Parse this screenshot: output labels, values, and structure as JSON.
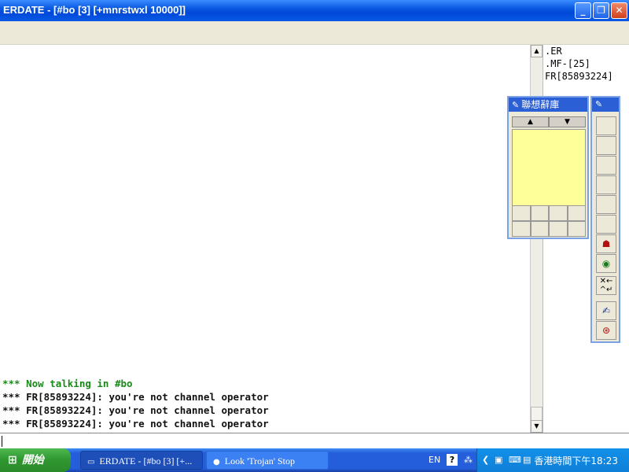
{
  "window": {
    "title": "ERDATE - [#bo [3] [+mnrstwxl 10000]]",
    "min_label": "_",
    "max_label": "❐",
    "close_label": "✕"
  },
  "chat": {
    "lines": [
      {
        "text": "*** Now talking in #bo",
        "color": "green"
      },
      {
        "text": "*** FR[85893224]: you're not channel operator",
        "color": "black"
      },
      {
        "text": "*** FR[85893224]: you're not channel operator",
        "color": "black"
      },
      {
        "text": "*** FR[85893224]: you're not channel operator",
        "color": "black"
      }
    ]
  },
  "nicklist": {
    "items": [
      ".ER",
      ".MF-[25]",
      "FR[85893224]"
    ]
  },
  "ime_panel": {
    "title": "聯想辭庫",
    "up_label": "▲",
    "down_label": "▼"
  },
  "taskbar": {
    "start_label": "開始",
    "tasks": [
      {
        "label": "ERDATE - [#bo [3] [+..."
      },
      {
        "label": "Look 'Trojan' Stop"
      }
    ],
    "language": "EN",
    "help": "?",
    "clock": "香港時間下午18:23"
  }
}
